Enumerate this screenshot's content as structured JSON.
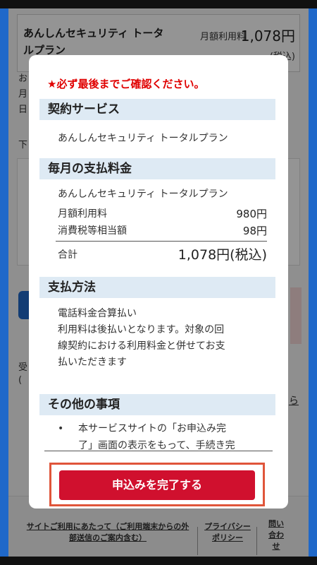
{
  "background": {
    "plan_name": "あんしんセキュリティ トータルプラン",
    "monthly_fee_label": "月額利用料",
    "monthly_fee_value": "1,078円",
    "tax_label": "(税込)",
    "text_fragments": [
      "お",
      "月",
      "日",
      "下",
      "受",
      "("
    ],
    "right_link_fragment": "ら",
    "footer": {
      "link_usage": "サイトご利用にあたって（ご利用端末からの外部送信のご案内含む）",
      "link_privacy": "プライバシーポリシー",
      "link_contact": "問い合わせ"
    }
  },
  "modal": {
    "notice": "★必ず最後までご確認ください。",
    "sections": {
      "contract": {
        "heading": "契約サービス",
        "service": "あんしんセキュリティ トータルプラン"
      },
      "payment_amount": {
        "heading": "毎月の支払料金",
        "plan": "あんしんセキュリティ トータルプラン",
        "monthly_label": "月額利用料",
        "monthly_value": "980円",
        "tax_label": "消費税等相当額",
        "tax_value": "98円",
        "total_label": "合計",
        "total_value": "1,078円(税込)"
      },
      "payment_method": {
        "heading": "支払方法",
        "method": "電話料金合算払い",
        "detail_lines": [
          "利用料は後払いとなります。対象の回",
          "線契約における利用料金と併せてお支",
          "払いただきます"
        ]
      },
      "other": {
        "heading": "その他の事項",
        "bullet_lines": [
          "本サービスサイトの「お申込み完",
          "了」画面の表示をもって、手続き完"
        ]
      }
    },
    "submit_button": "申込みを完了する"
  }
}
